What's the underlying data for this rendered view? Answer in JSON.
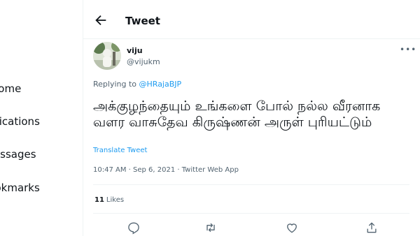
{
  "sidebar": {
    "items": [
      {
        "label": "Home"
      },
      {
        "label": "Notifications"
      },
      {
        "label": "Messages"
      },
      {
        "label": "Bookmarks"
      }
    ]
  },
  "header": {
    "title": "Tweet",
    "back_icon": "arrow-left-icon"
  },
  "tweet": {
    "user_name": "viju",
    "handle": "@vijukm",
    "replying_prefix": "Replying to",
    "replying_to": "@HRajaBJP",
    "text": "அக்குழந்தையும் உங்களை போல் நல்ல வீரனாக வளர வாசுதேவ கிருஷ்ணன் அருள் புரியட்டும்",
    "translate_label": "Translate Tweet",
    "timestamp": "10:47 AM · Sep 6, 2021 · Twitter Web App",
    "likes_count": "11",
    "likes_label": "Likes",
    "more_icon": "more-icon"
  },
  "actions": [
    "reply-icon",
    "retweet-icon",
    "like-icon",
    "share-icon"
  ],
  "colors": {
    "accent": "#1d9bf0",
    "text": "#0f1419",
    "muted": "#536471",
    "border": "#eff3f4"
  }
}
